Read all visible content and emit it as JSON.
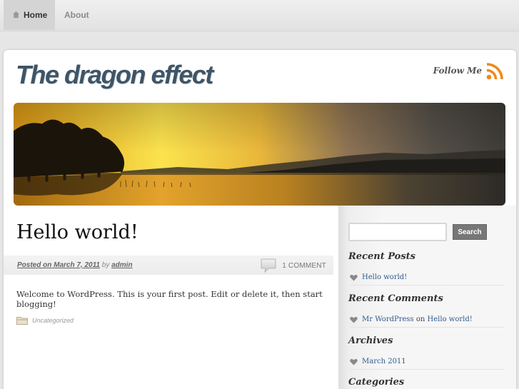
{
  "nav": {
    "home": "Home",
    "about": "About"
  },
  "site": {
    "title": "The dragon effect",
    "follow_label": "Follow Me"
  },
  "post": {
    "title": "Hello world!",
    "posted_on_label": "Posted on",
    "date": "March 7, 2011",
    "by_label": "by",
    "author": "admin",
    "comment_count": "1 COMMENT",
    "body": "Welcome to WordPress. This is your first post. Edit or delete it, then start blogging!",
    "category": "Uncategorized"
  },
  "sidebar": {
    "search_button": "Search",
    "search_value": "",
    "recent_posts": {
      "title": "Recent Posts",
      "items": [
        "Hello world!"
      ]
    },
    "recent_comments": {
      "title": "Recent Comments",
      "author": "Mr WordPress",
      "on_label": "on",
      "post": "Hello world!"
    },
    "archives": {
      "title": "Archives",
      "items": [
        "March 2011"
      ]
    },
    "categories": {
      "title": "Categories"
    }
  },
  "colors": {
    "title_blue": "#3d5568",
    "rss_orange": "#f08a1c",
    "link_blue": "#2f5b8b",
    "search_button": "#777777"
  },
  "icons": {
    "home": "home-icon",
    "rss": "rss-icon",
    "comment": "speech-bubble-icon",
    "category": "folder-icon",
    "list_bullet": "heart-icon"
  }
}
